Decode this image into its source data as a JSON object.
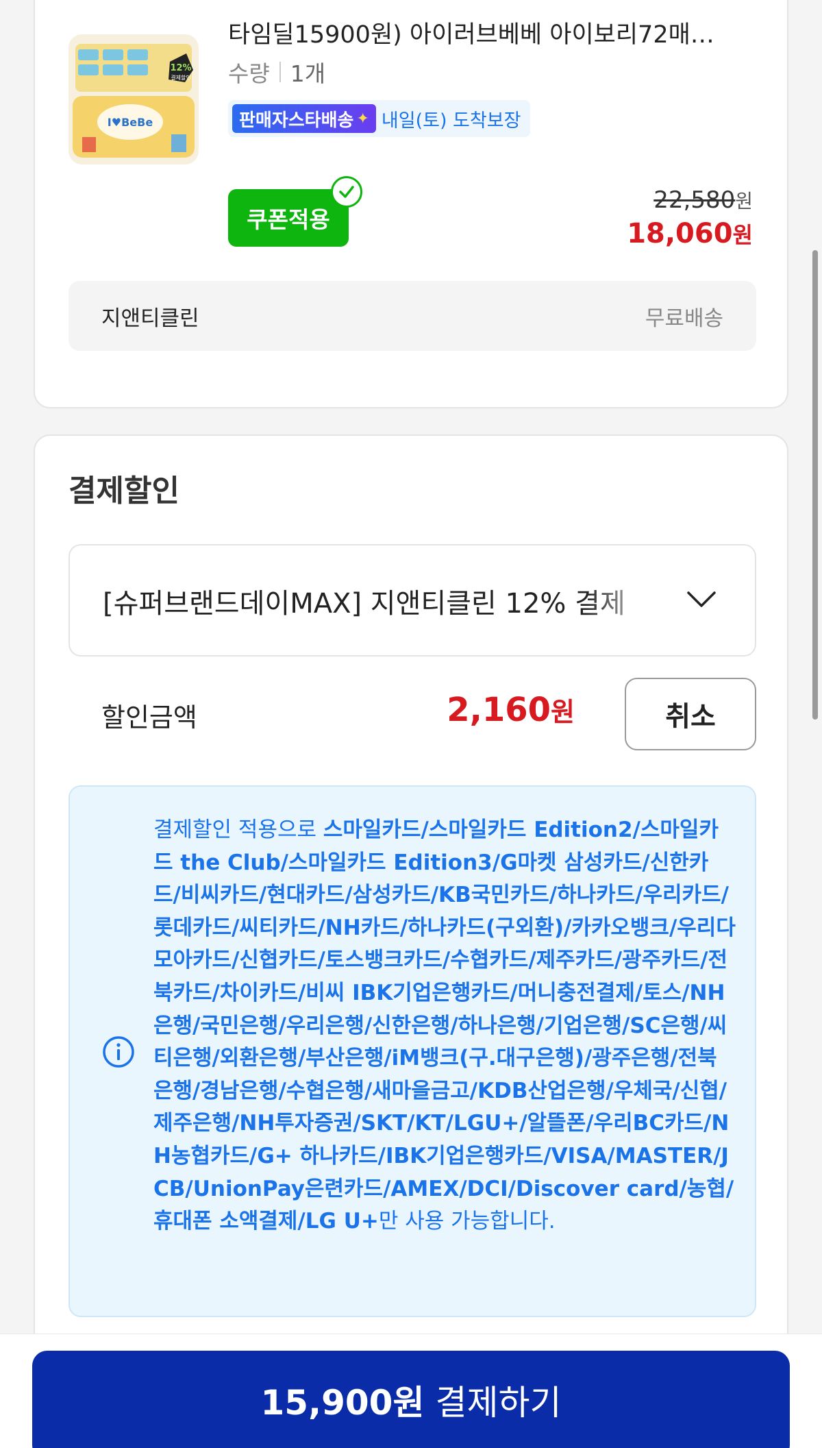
{
  "product": {
    "title": "타임딜15900원) 아이러브베베 아이보리72매…",
    "qty_label": "수량",
    "qty_value": "1개",
    "seller_badge_text": "판매자스타배송",
    "ship_text": "내일(토) 도착보장",
    "coupon_label": "쿠폰적용",
    "original_price": "22,580",
    "original_price_unit": "원",
    "final_price": "18,060",
    "final_price_unit": "원",
    "thumb_badge_pct": "12%",
    "thumb_badge_text": "결제할인",
    "thumb_brand": "I♥BeBe",
    "seller_name": "지앤티클린",
    "delivery_fee": "무료배송"
  },
  "discount": {
    "title": "결제할인",
    "selected_option": "[슈퍼브랜드데이MAX] 지앤티클린 12% 결제",
    "amount_label": "할인금액",
    "amount_value": "2,160",
    "amount_unit": "원",
    "cancel_label": "취소",
    "info_prefix": "결제할인 적용으로 ",
    "info_cards": "스마일카드/스마일카드 Edition2/스마일카드 the Club/스마일카드 Edition3/G마켓 삼성카드/신한카드/비씨카드/현대카드/삼성카드/KB국민카드/하나카드/우리카드/롯데카드/씨티카드/NH카드/하나카드(구외환)/카카오뱅크/우리다모아카드/신협카드/토스뱅크카드/수협카드/제주카드/광주카드/전북카드/차이카드/비씨 IBK기업은행카드/머니충전결제/토스/NH은행/국민은행/우리은행/신한은행/하나은행/기업은행/SC은행/씨티은행/외환은행/부산은행/iM뱅크(구.대구은행)/광주은행/전북은행/경남은행/수협은행/새마을금고/KDB산업은행/우체국/신협/제주은행/NH투자증권/SKT/KT/LGU+/알뜰폰/우리BC카드/NH농협카드/G+ 하나카드/IBK기업은행카드/VISA/MASTER/JCB/UnionPay은련카드/AMEX/DCI/Discover card/농협/휴대폰 소액결제/LG U+",
    "info_suffix": "만 사용 가능합니다."
  },
  "checkout": {
    "amount": "15,900원",
    "label": "결제하기"
  },
  "colors": {
    "accent_red": "#d71920",
    "coupon_green": "#0fb50f",
    "info_blue": "#1a73e8",
    "pay_button": "#0a2ca8"
  },
  "icons": {
    "coupon_check": "check-circle-icon",
    "select_chevron": "chevron-down-icon",
    "info": "info-circle-icon",
    "delivery_sparkle": "sparkle-icon"
  }
}
